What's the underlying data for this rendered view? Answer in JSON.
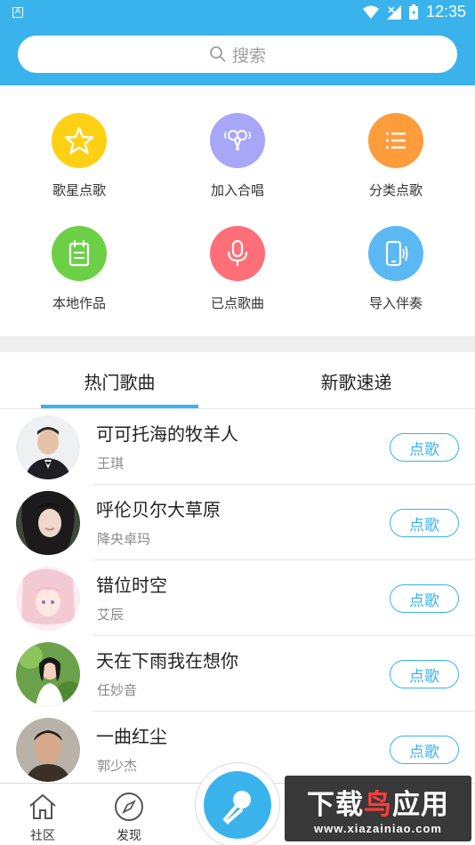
{
  "status_bar": {
    "time": "12:35",
    "notification_icon_letter": "A"
  },
  "search": {
    "placeholder": "搜索"
  },
  "grid": [
    {
      "label": "歌星点歌",
      "color": "#ffd115",
      "icon": "star-icon"
    },
    {
      "label": "加入合唱",
      "color": "#a7a6f7",
      "icon": "chorus-mic-icon"
    },
    {
      "label": "分类点歌",
      "color": "#ff9c3c",
      "icon": "list-icon"
    },
    {
      "label": "本地作品",
      "color": "#6cd047",
      "icon": "calendar-doc-icon"
    },
    {
      "label": "已点歌曲",
      "color": "#ff6f78",
      "icon": "microphone-icon"
    },
    {
      "label": "导入伴奏",
      "color": "#5cb8f2",
      "icon": "phone-sound-icon"
    }
  ],
  "tabs": [
    {
      "label": "热门歌曲",
      "active": true
    },
    {
      "label": "新歌速递",
      "active": false
    }
  ],
  "songs": [
    {
      "title": "可可托海的牧羊人",
      "artist": "王琪",
      "button": "点歌"
    },
    {
      "title": "呼伦贝尔大草原",
      "artist": "降央卓玛",
      "button": "点歌"
    },
    {
      "title": "错位时空",
      "artist": "艾辰",
      "button": "点歌"
    },
    {
      "title": "天在下雨我在想你",
      "artist": "任妙音",
      "button": "点歌"
    },
    {
      "title": "一曲红尘",
      "artist": "郭少杰",
      "button": "点歌"
    }
  ],
  "bottom_nav": [
    {
      "label": "社区",
      "icon": "home-icon"
    },
    {
      "label": "发现",
      "icon": "compass-icon"
    }
  ],
  "watermark": {
    "brand_part1": "下载",
    "brand_part2": "鸟",
    "brand_part3": "应用",
    "url": "www.xiazainiao.com"
  },
  "colors": {
    "accent": "#3ab3ec",
    "divider": "#e6e6e6",
    "section_gap": "#eeeeee"
  }
}
